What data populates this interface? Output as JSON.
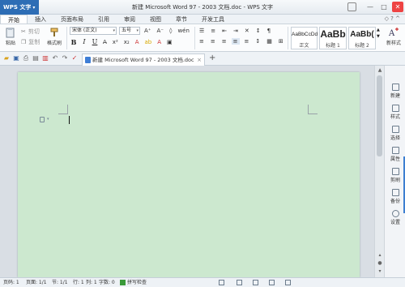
{
  "app": {
    "menu_label": "WPS 文字",
    "title": "新建 Microsoft Word 97 - 2003 文档.doc - WPS 文字"
  },
  "window_controls": {
    "minimize": "—",
    "maximize": "□",
    "close": "✕"
  },
  "menu": {
    "tabs": [
      "开始",
      "插入",
      "页面布局",
      "引用",
      "审阅",
      "视图",
      "章节",
      "开发工具"
    ],
    "active_index": 0
  },
  "ribbon": {
    "paste_label": "粘贴",
    "cut_label": "剪切",
    "copy_label": "复制",
    "format_painter_label": "格式刷",
    "font_name": "宋体 (正文)",
    "font_size": "五号",
    "bold": "B",
    "italic": "I",
    "underline": "U",
    "styles": [
      {
        "sample": "AaBbCcDd",
        "label": "正文"
      },
      {
        "sample": "AaBb",
        "label": "标题 1"
      },
      {
        "sample": "AaBb(",
        "label": "标题 2"
      }
    ],
    "new_style_label": "新样式"
  },
  "document_tab": {
    "name": "新建 Microsoft Word 97 - 2003 文档.doc",
    "close": "×",
    "add": "+"
  },
  "task_pane": {
    "items": [
      "新建",
      "样式",
      "选择",
      "属性",
      "剪刷",
      "备份",
      "设置"
    ]
  },
  "status_bar": {
    "page": "页码: 1",
    "pages": "页面: 1/1",
    "section": "节: 1/1",
    "line": "行: 1",
    "column": "列: 1",
    "words": "字数: 0",
    "spell_check": "拼写检查"
  },
  "colors": {
    "page_background": "#cce8cf",
    "app_menu_blue": "#2d6db5",
    "close_red": "#e44444"
  },
  "icons": {
    "quick_access": [
      "open-icon",
      "save-icon",
      "print-icon",
      "preview-icon",
      "export-icon",
      "undo-icon",
      "redo-icon",
      "check-icon"
    ]
  }
}
